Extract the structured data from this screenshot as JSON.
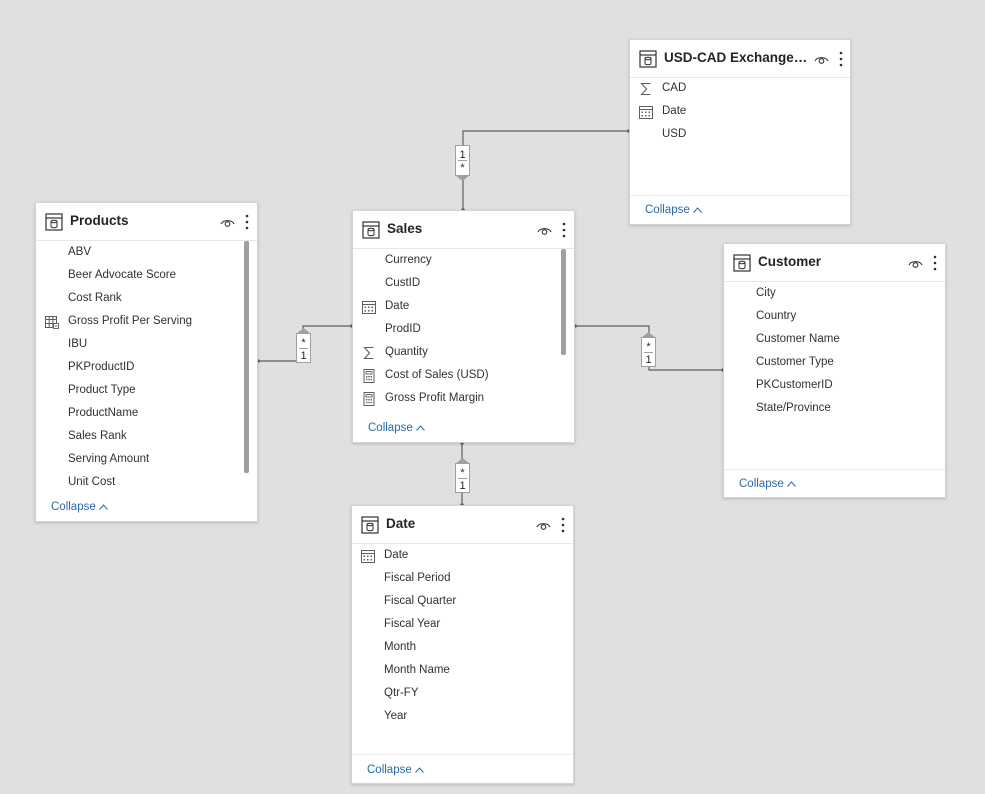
{
  "tables": {
    "products": {
      "title": "Products",
      "fields": [
        "ABV",
        "Beer Advocate Score",
        "Cost Rank",
        "Gross Profit Per Serving",
        "IBU",
        "PKProductID",
        "Product Type",
        "ProductName",
        "Sales Rank",
        "Serving Amount",
        "Unit Cost"
      ],
      "field_icons": [
        "none",
        "none",
        "none",
        "calc-column",
        "none",
        "none",
        "none",
        "none",
        "none",
        "none",
        "none"
      ],
      "collapse": "Collapse"
    },
    "sales": {
      "title": "Sales",
      "fields": [
        "Currency",
        "CustID",
        "Date",
        "ProdID",
        "Quantity",
        "Cost of Sales (USD)",
        "Gross Profit Margin"
      ],
      "field_icons": [
        "none",
        "none",
        "calendar",
        "none",
        "sigma",
        "calculator",
        "calculator"
      ],
      "collapse": "Collapse"
    },
    "usdcad": {
      "title": "USD-CAD Exchange R...",
      "fields": [
        "CAD",
        "Date",
        "USD"
      ],
      "field_icons": [
        "sigma",
        "calendar",
        "none"
      ],
      "collapse": "Collapse"
    },
    "customer": {
      "title": "Customer",
      "fields": [
        "City",
        "Country",
        "Customer Name",
        "Customer Type",
        "PKCustomerID",
        "State/Province"
      ],
      "field_icons": [
        "none",
        "none",
        "none",
        "none",
        "none",
        "none"
      ],
      "collapse": "Collapse"
    },
    "date": {
      "title": "Date",
      "fields": [
        "Date",
        "Fiscal Period",
        "Fiscal Quarter",
        "Fiscal Year",
        "Month",
        "Month Name",
        "Qtr-FY",
        "Year"
      ],
      "field_icons": [
        "calendar",
        "none",
        "none",
        "none",
        "none",
        "none",
        "none",
        "none"
      ],
      "collapse": "Collapse"
    }
  },
  "relationships": {
    "usdcad_sales": {
      "top": "1",
      "bottom": "*"
    },
    "products_sales": {
      "top": "*",
      "bottom": "1"
    },
    "sales_customer": {
      "top": "*",
      "bottom": "1"
    },
    "sales_date": {
      "top": "*",
      "bottom": "1"
    }
  },
  "colors": {
    "canvas": "#e1e0df",
    "link": "#2b69a8",
    "line": "#605e5c"
  }
}
